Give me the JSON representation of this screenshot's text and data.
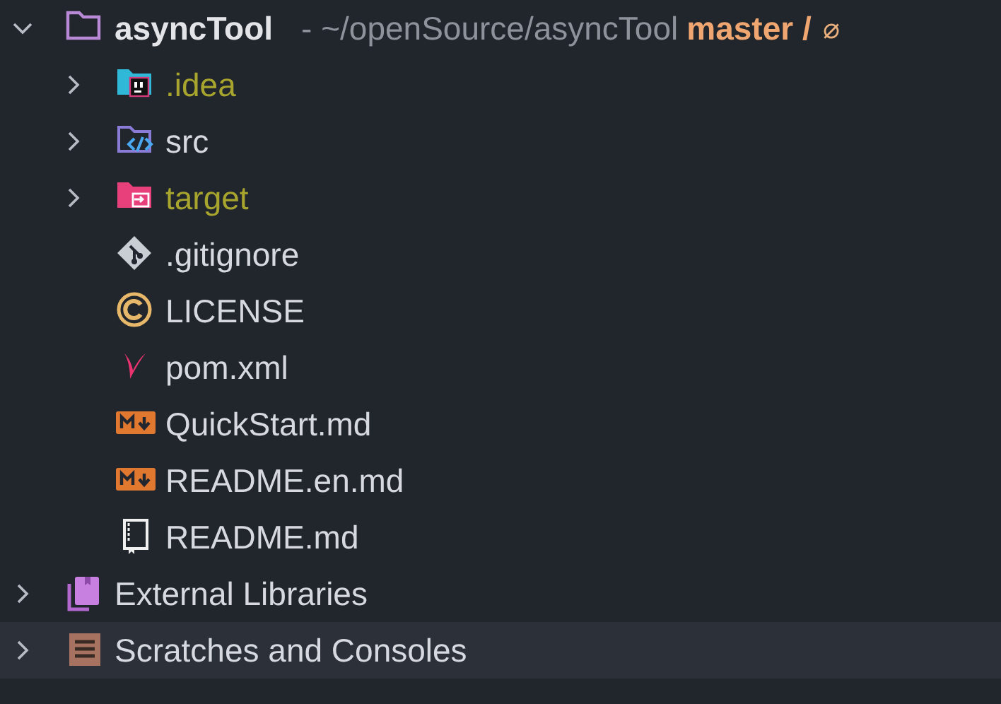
{
  "tree": [
    {
      "kind": "module",
      "name": "asyncTool",
      "location": "- ~/openSource/asyncTool",
      "branch": "master /",
      "branch_status": "⌀",
      "expanded": true,
      "selected": false,
      "ignored": false,
      "children": [
        {
          "kind": "idea-folder",
          "name": ".idea",
          "expanded": false,
          "selected": false,
          "ignored": true
        },
        {
          "kind": "source-folder",
          "name": "src",
          "expanded": false,
          "selected": false,
          "ignored": false
        },
        {
          "kind": "target-folder",
          "name": "target",
          "expanded": false,
          "selected": false,
          "ignored": true
        },
        {
          "kind": "gitignore",
          "name": ".gitignore",
          "selected": false,
          "ignored": false
        },
        {
          "kind": "license",
          "name": "LICENSE",
          "selected": false,
          "ignored": false
        },
        {
          "kind": "maven",
          "name": "pom.xml",
          "selected": false,
          "ignored": false
        },
        {
          "kind": "markdown",
          "name": "QuickStart.md",
          "selected": false,
          "ignored": false
        },
        {
          "kind": "markdown",
          "name": "README.en.md",
          "selected": false,
          "ignored": false
        },
        {
          "kind": "readme",
          "name": "README.md",
          "selected": false,
          "ignored": false
        }
      ]
    },
    {
      "kind": "libraries",
      "name": "External Libraries",
      "expanded": false,
      "selected": false,
      "ignored": false
    },
    {
      "kind": "scratches",
      "name": "Scratches and Consoles",
      "expanded": false,
      "selected": true,
      "ignored": false
    }
  ]
}
